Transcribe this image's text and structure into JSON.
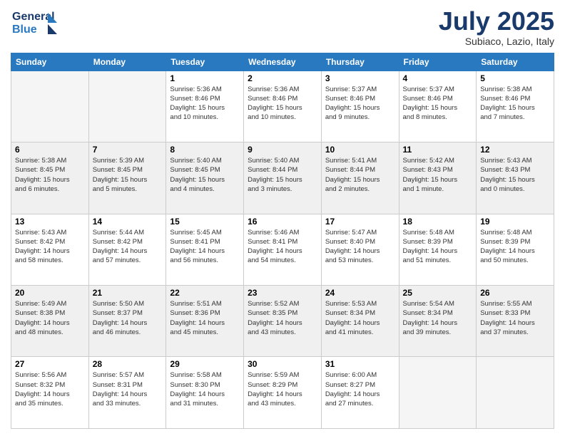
{
  "header": {
    "logo_line1": "General",
    "logo_line2": "Blue",
    "month": "July 2025",
    "location": "Subiaco, Lazio, Italy"
  },
  "weekdays": [
    "Sunday",
    "Monday",
    "Tuesday",
    "Wednesday",
    "Thursday",
    "Friday",
    "Saturday"
  ],
  "weeks": [
    [
      {
        "day": "",
        "info": ""
      },
      {
        "day": "",
        "info": ""
      },
      {
        "day": "1",
        "info": "Sunrise: 5:36 AM\nSunset: 8:46 PM\nDaylight: 15 hours\nand 10 minutes."
      },
      {
        "day": "2",
        "info": "Sunrise: 5:36 AM\nSunset: 8:46 PM\nDaylight: 15 hours\nand 10 minutes."
      },
      {
        "day": "3",
        "info": "Sunrise: 5:37 AM\nSunset: 8:46 PM\nDaylight: 15 hours\nand 9 minutes."
      },
      {
        "day": "4",
        "info": "Sunrise: 5:37 AM\nSunset: 8:46 PM\nDaylight: 15 hours\nand 8 minutes."
      },
      {
        "day": "5",
        "info": "Sunrise: 5:38 AM\nSunset: 8:46 PM\nDaylight: 15 hours\nand 7 minutes."
      }
    ],
    [
      {
        "day": "6",
        "info": "Sunrise: 5:38 AM\nSunset: 8:45 PM\nDaylight: 15 hours\nand 6 minutes."
      },
      {
        "day": "7",
        "info": "Sunrise: 5:39 AM\nSunset: 8:45 PM\nDaylight: 15 hours\nand 5 minutes."
      },
      {
        "day": "8",
        "info": "Sunrise: 5:40 AM\nSunset: 8:45 PM\nDaylight: 15 hours\nand 4 minutes."
      },
      {
        "day": "9",
        "info": "Sunrise: 5:40 AM\nSunset: 8:44 PM\nDaylight: 15 hours\nand 3 minutes."
      },
      {
        "day": "10",
        "info": "Sunrise: 5:41 AM\nSunset: 8:44 PM\nDaylight: 15 hours\nand 2 minutes."
      },
      {
        "day": "11",
        "info": "Sunrise: 5:42 AM\nSunset: 8:43 PM\nDaylight: 15 hours\nand 1 minute."
      },
      {
        "day": "12",
        "info": "Sunrise: 5:43 AM\nSunset: 8:43 PM\nDaylight: 15 hours\nand 0 minutes."
      }
    ],
    [
      {
        "day": "13",
        "info": "Sunrise: 5:43 AM\nSunset: 8:42 PM\nDaylight: 14 hours\nand 58 minutes."
      },
      {
        "day": "14",
        "info": "Sunrise: 5:44 AM\nSunset: 8:42 PM\nDaylight: 14 hours\nand 57 minutes."
      },
      {
        "day": "15",
        "info": "Sunrise: 5:45 AM\nSunset: 8:41 PM\nDaylight: 14 hours\nand 56 minutes."
      },
      {
        "day": "16",
        "info": "Sunrise: 5:46 AM\nSunset: 8:41 PM\nDaylight: 14 hours\nand 54 minutes."
      },
      {
        "day": "17",
        "info": "Sunrise: 5:47 AM\nSunset: 8:40 PM\nDaylight: 14 hours\nand 53 minutes."
      },
      {
        "day": "18",
        "info": "Sunrise: 5:48 AM\nSunset: 8:39 PM\nDaylight: 14 hours\nand 51 minutes."
      },
      {
        "day": "19",
        "info": "Sunrise: 5:48 AM\nSunset: 8:39 PM\nDaylight: 14 hours\nand 50 minutes."
      }
    ],
    [
      {
        "day": "20",
        "info": "Sunrise: 5:49 AM\nSunset: 8:38 PM\nDaylight: 14 hours\nand 48 minutes."
      },
      {
        "day": "21",
        "info": "Sunrise: 5:50 AM\nSunset: 8:37 PM\nDaylight: 14 hours\nand 46 minutes."
      },
      {
        "day": "22",
        "info": "Sunrise: 5:51 AM\nSunset: 8:36 PM\nDaylight: 14 hours\nand 45 minutes."
      },
      {
        "day": "23",
        "info": "Sunrise: 5:52 AM\nSunset: 8:35 PM\nDaylight: 14 hours\nand 43 minutes."
      },
      {
        "day": "24",
        "info": "Sunrise: 5:53 AM\nSunset: 8:34 PM\nDaylight: 14 hours\nand 41 minutes."
      },
      {
        "day": "25",
        "info": "Sunrise: 5:54 AM\nSunset: 8:34 PM\nDaylight: 14 hours\nand 39 minutes."
      },
      {
        "day": "26",
        "info": "Sunrise: 5:55 AM\nSunset: 8:33 PM\nDaylight: 14 hours\nand 37 minutes."
      }
    ],
    [
      {
        "day": "27",
        "info": "Sunrise: 5:56 AM\nSunset: 8:32 PM\nDaylight: 14 hours\nand 35 minutes."
      },
      {
        "day": "28",
        "info": "Sunrise: 5:57 AM\nSunset: 8:31 PM\nDaylight: 14 hours\nand 33 minutes."
      },
      {
        "day": "29",
        "info": "Sunrise: 5:58 AM\nSunset: 8:30 PM\nDaylight: 14 hours\nand 31 minutes."
      },
      {
        "day": "30",
        "info": "Sunrise: 5:59 AM\nSunset: 8:29 PM\nDaylight: 14 hours\nand 43 minutes."
      },
      {
        "day": "31",
        "info": "Sunrise: 6:00 AM\nSunset: 8:27 PM\nDaylight: 14 hours\nand 27 minutes."
      },
      {
        "day": "",
        "info": ""
      },
      {
        "day": "",
        "info": ""
      }
    ]
  ]
}
